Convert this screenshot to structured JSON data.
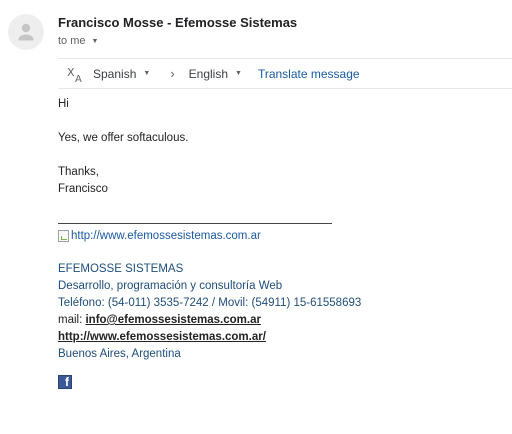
{
  "email": {
    "sender_name": "Francisco Mosse - Efemosse Sistemas",
    "recipient_label": "to me"
  },
  "translate": {
    "source_language": "Spanish",
    "target_language": "English",
    "translate_link": "Translate message"
  },
  "message": {
    "greeting": "Hi",
    "line1": "Yes, we offer softaculous.",
    "closing": "Thanks,",
    "signoff_name": "Francisco"
  },
  "signature": {
    "logo_alt": "http://www.efemossesistemas.com.ar",
    "company": "EFEMOSSE SISTEMAS",
    "tagline": "Desarrollo, programación y consultoría Web",
    "phones": "Teléfono: (54-011) 3535-7242 / Movil: (54911) 15-61558693",
    "mail_label": "mail:",
    "mail": "info@efemossesistemas.com.ar",
    "website": "http://www.efemossesistemas.com.ar/",
    "location": "Buenos Aires, Argentina",
    "social_icon": "facebook-icon",
    "facebook_glyph": "f"
  },
  "colors": {
    "link_blue": "#1a5a9e",
    "signature_blue": "#1f4e79",
    "facebook_blue": "#3b5998"
  }
}
